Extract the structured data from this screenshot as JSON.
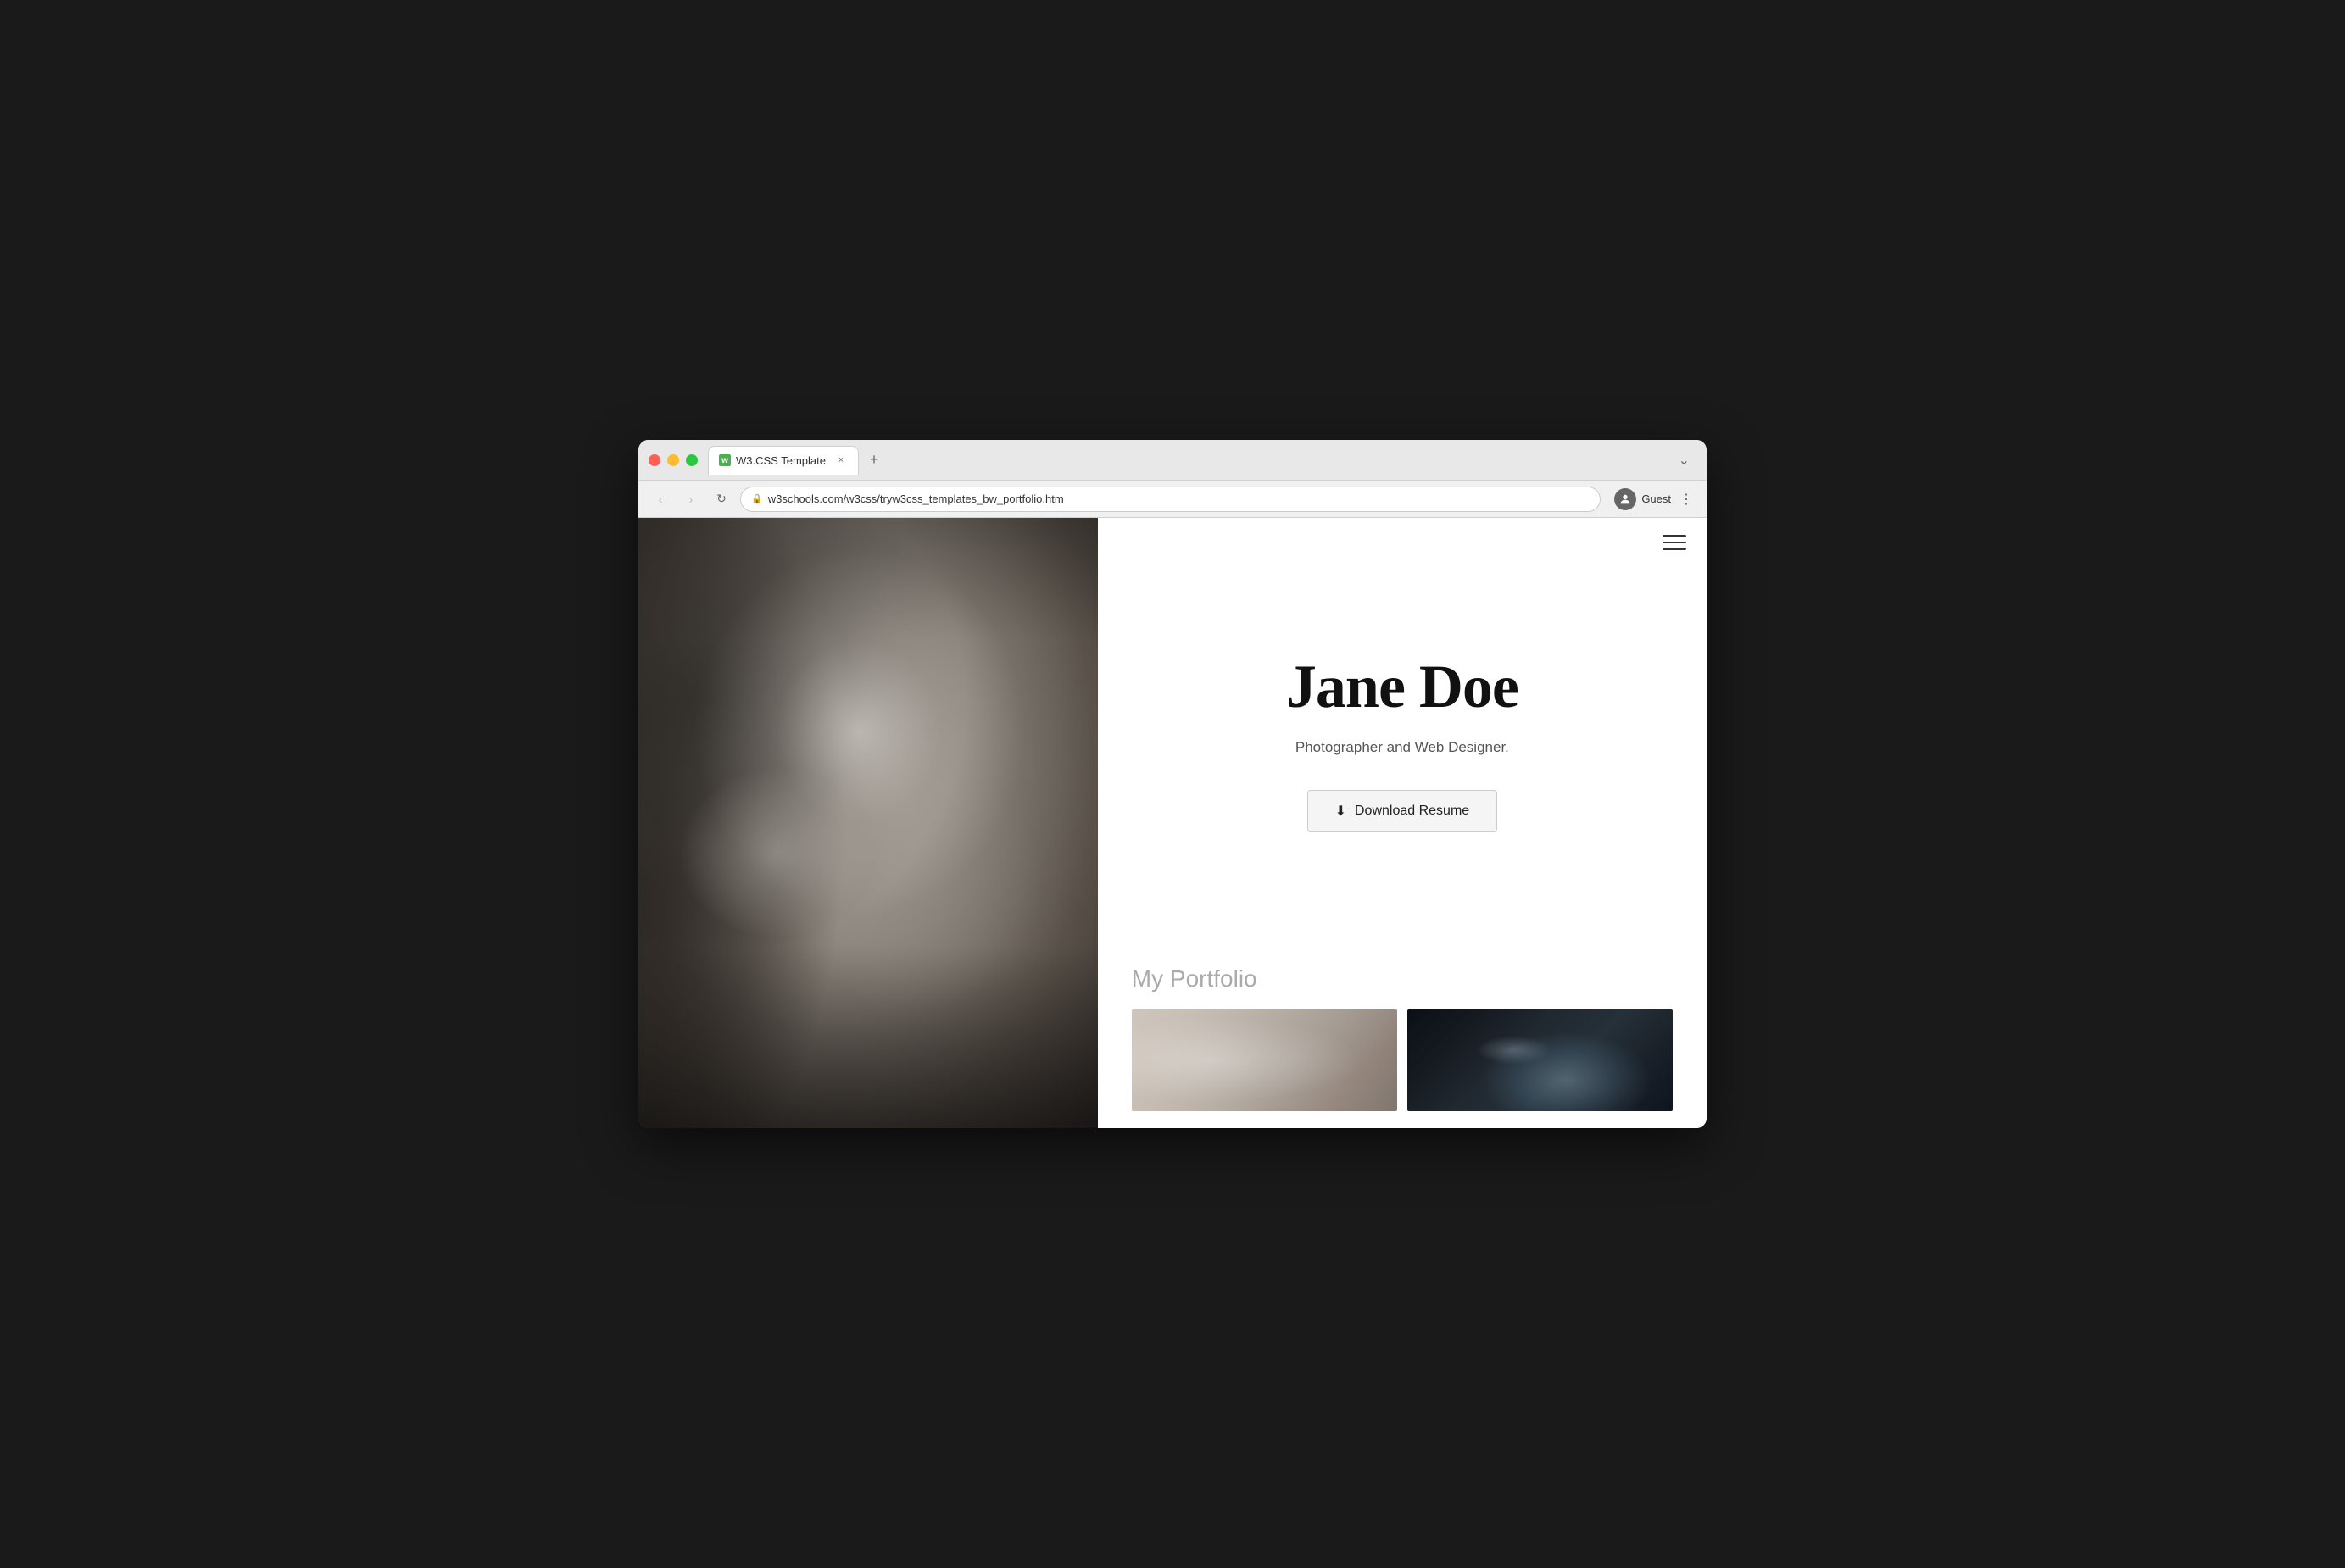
{
  "browser": {
    "tab_title": "W3.CSS Template",
    "tab_close_label": "×",
    "tab_new_label": "+",
    "tab_more_label": "⌄",
    "nav_back_label": "‹",
    "nav_forward_label": "›",
    "nav_refresh_label": "↻",
    "url_lock_icon": "🔒",
    "url": "w3schools.com/w3css/tryw3css_templates_bw_portfolio.htm",
    "profile_icon": "👤",
    "profile_name": "Guest",
    "menu_dots_label": "⋮"
  },
  "site": {
    "hamburger_label": "☰",
    "hero_name": "Jane Doe",
    "hero_subtitle": "Photographer and Web Designer.",
    "download_btn_label": "Download Resume",
    "download_icon": "⬇",
    "portfolio_title": "My Portfolio"
  },
  "colors": {
    "accent": "#333333",
    "background": "#ffffff",
    "text_primary": "#111111",
    "text_secondary": "#555555",
    "btn_bg": "#f5f5f5",
    "btn_border": "#cccccc"
  }
}
